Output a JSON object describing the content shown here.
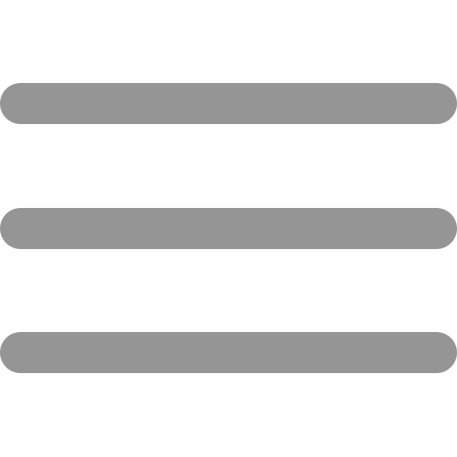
{
  "icon": {
    "name": "hamburger-menu-icon",
    "bar_count": 3,
    "color": "#959595",
    "background": "#ffffff"
  }
}
